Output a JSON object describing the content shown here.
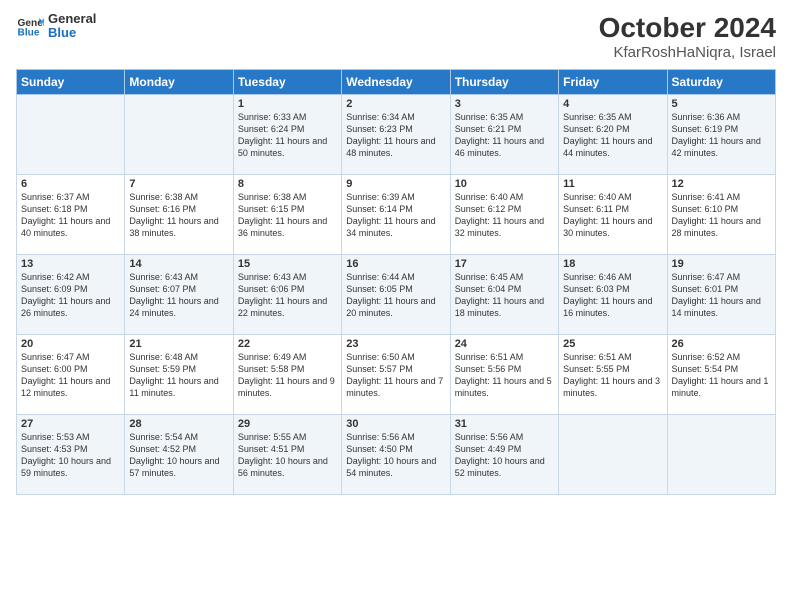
{
  "header": {
    "logo_general": "General",
    "logo_blue": "Blue",
    "title": "October 2024",
    "subtitle": "KfarRoshHaNiqra, Israel"
  },
  "weekdays": [
    "Sunday",
    "Monday",
    "Tuesday",
    "Wednesday",
    "Thursday",
    "Friday",
    "Saturday"
  ],
  "weeks": [
    [
      {
        "day": "",
        "sunrise": "",
        "sunset": "",
        "daylight": ""
      },
      {
        "day": "",
        "sunrise": "",
        "sunset": "",
        "daylight": ""
      },
      {
        "day": "1",
        "sunrise": "Sunrise: 6:33 AM",
        "sunset": "Sunset: 6:24 PM",
        "daylight": "Daylight: 11 hours and 50 minutes."
      },
      {
        "day": "2",
        "sunrise": "Sunrise: 6:34 AM",
        "sunset": "Sunset: 6:23 PM",
        "daylight": "Daylight: 11 hours and 48 minutes."
      },
      {
        "day": "3",
        "sunrise": "Sunrise: 6:35 AM",
        "sunset": "Sunset: 6:21 PM",
        "daylight": "Daylight: 11 hours and 46 minutes."
      },
      {
        "day": "4",
        "sunrise": "Sunrise: 6:35 AM",
        "sunset": "Sunset: 6:20 PM",
        "daylight": "Daylight: 11 hours and 44 minutes."
      },
      {
        "day": "5",
        "sunrise": "Sunrise: 6:36 AM",
        "sunset": "Sunset: 6:19 PM",
        "daylight": "Daylight: 11 hours and 42 minutes."
      }
    ],
    [
      {
        "day": "6",
        "sunrise": "Sunrise: 6:37 AM",
        "sunset": "Sunset: 6:18 PM",
        "daylight": "Daylight: 11 hours and 40 minutes."
      },
      {
        "day": "7",
        "sunrise": "Sunrise: 6:38 AM",
        "sunset": "Sunset: 6:16 PM",
        "daylight": "Daylight: 11 hours and 38 minutes."
      },
      {
        "day": "8",
        "sunrise": "Sunrise: 6:38 AM",
        "sunset": "Sunset: 6:15 PM",
        "daylight": "Daylight: 11 hours and 36 minutes."
      },
      {
        "day": "9",
        "sunrise": "Sunrise: 6:39 AM",
        "sunset": "Sunset: 6:14 PM",
        "daylight": "Daylight: 11 hours and 34 minutes."
      },
      {
        "day": "10",
        "sunrise": "Sunrise: 6:40 AM",
        "sunset": "Sunset: 6:12 PM",
        "daylight": "Daylight: 11 hours and 32 minutes."
      },
      {
        "day": "11",
        "sunrise": "Sunrise: 6:40 AM",
        "sunset": "Sunset: 6:11 PM",
        "daylight": "Daylight: 11 hours and 30 minutes."
      },
      {
        "day": "12",
        "sunrise": "Sunrise: 6:41 AM",
        "sunset": "Sunset: 6:10 PM",
        "daylight": "Daylight: 11 hours and 28 minutes."
      }
    ],
    [
      {
        "day": "13",
        "sunrise": "Sunrise: 6:42 AM",
        "sunset": "Sunset: 6:09 PM",
        "daylight": "Daylight: 11 hours and 26 minutes."
      },
      {
        "day": "14",
        "sunrise": "Sunrise: 6:43 AM",
        "sunset": "Sunset: 6:07 PM",
        "daylight": "Daylight: 11 hours and 24 minutes."
      },
      {
        "day": "15",
        "sunrise": "Sunrise: 6:43 AM",
        "sunset": "Sunset: 6:06 PM",
        "daylight": "Daylight: 11 hours and 22 minutes."
      },
      {
        "day": "16",
        "sunrise": "Sunrise: 6:44 AM",
        "sunset": "Sunset: 6:05 PM",
        "daylight": "Daylight: 11 hours and 20 minutes."
      },
      {
        "day": "17",
        "sunrise": "Sunrise: 6:45 AM",
        "sunset": "Sunset: 6:04 PM",
        "daylight": "Daylight: 11 hours and 18 minutes."
      },
      {
        "day": "18",
        "sunrise": "Sunrise: 6:46 AM",
        "sunset": "Sunset: 6:03 PM",
        "daylight": "Daylight: 11 hours and 16 minutes."
      },
      {
        "day": "19",
        "sunrise": "Sunrise: 6:47 AM",
        "sunset": "Sunset: 6:01 PM",
        "daylight": "Daylight: 11 hours and 14 minutes."
      }
    ],
    [
      {
        "day": "20",
        "sunrise": "Sunrise: 6:47 AM",
        "sunset": "Sunset: 6:00 PM",
        "daylight": "Daylight: 11 hours and 12 minutes."
      },
      {
        "day": "21",
        "sunrise": "Sunrise: 6:48 AM",
        "sunset": "Sunset: 5:59 PM",
        "daylight": "Daylight: 11 hours and 11 minutes."
      },
      {
        "day": "22",
        "sunrise": "Sunrise: 6:49 AM",
        "sunset": "Sunset: 5:58 PM",
        "daylight": "Daylight: 11 hours and 9 minutes."
      },
      {
        "day": "23",
        "sunrise": "Sunrise: 6:50 AM",
        "sunset": "Sunset: 5:57 PM",
        "daylight": "Daylight: 11 hours and 7 minutes."
      },
      {
        "day": "24",
        "sunrise": "Sunrise: 6:51 AM",
        "sunset": "Sunset: 5:56 PM",
        "daylight": "Daylight: 11 hours and 5 minutes."
      },
      {
        "day": "25",
        "sunrise": "Sunrise: 6:51 AM",
        "sunset": "Sunset: 5:55 PM",
        "daylight": "Daylight: 11 hours and 3 minutes."
      },
      {
        "day": "26",
        "sunrise": "Sunrise: 6:52 AM",
        "sunset": "Sunset: 5:54 PM",
        "daylight": "Daylight: 11 hours and 1 minute."
      }
    ],
    [
      {
        "day": "27",
        "sunrise": "Sunrise: 5:53 AM",
        "sunset": "Sunset: 4:53 PM",
        "daylight": "Daylight: 10 hours and 59 minutes."
      },
      {
        "day": "28",
        "sunrise": "Sunrise: 5:54 AM",
        "sunset": "Sunset: 4:52 PM",
        "daylight": "Daylight: 10 hours and 57 minutes."
      },
      {
        "day": "29",
        "sunrise": "Sunrise: 5:55 AM",
        "sunset": "Sunset: 4:51 PM",
        "daylight": "Daylight: 10 hours and 56 minutes."
      },
      {
        "day": "30",
        "sunrise": "Sunrise: 5:56 AM",
        "sunset": "Sunset: 4:50 PM",
        "daylight": "Daylight: 10 hours and 54 minutes."
      },
      {
        "day": "31",
        "sunrise": "Sunrise: 5:56 AM",
        "sunset": "Sunset: 4:49 PM",
        "daylight": "Daylight: 10 hours and 52 minutes."
      },
      {
        "day": "",
        "sunrise": "",
        "sunset": "",
        "daylight": ""
      },
      {
        "day": "",
        "sunrise": "",
        "sunset": "",
        "daylight": ""
      }
    ]
  ]
}
